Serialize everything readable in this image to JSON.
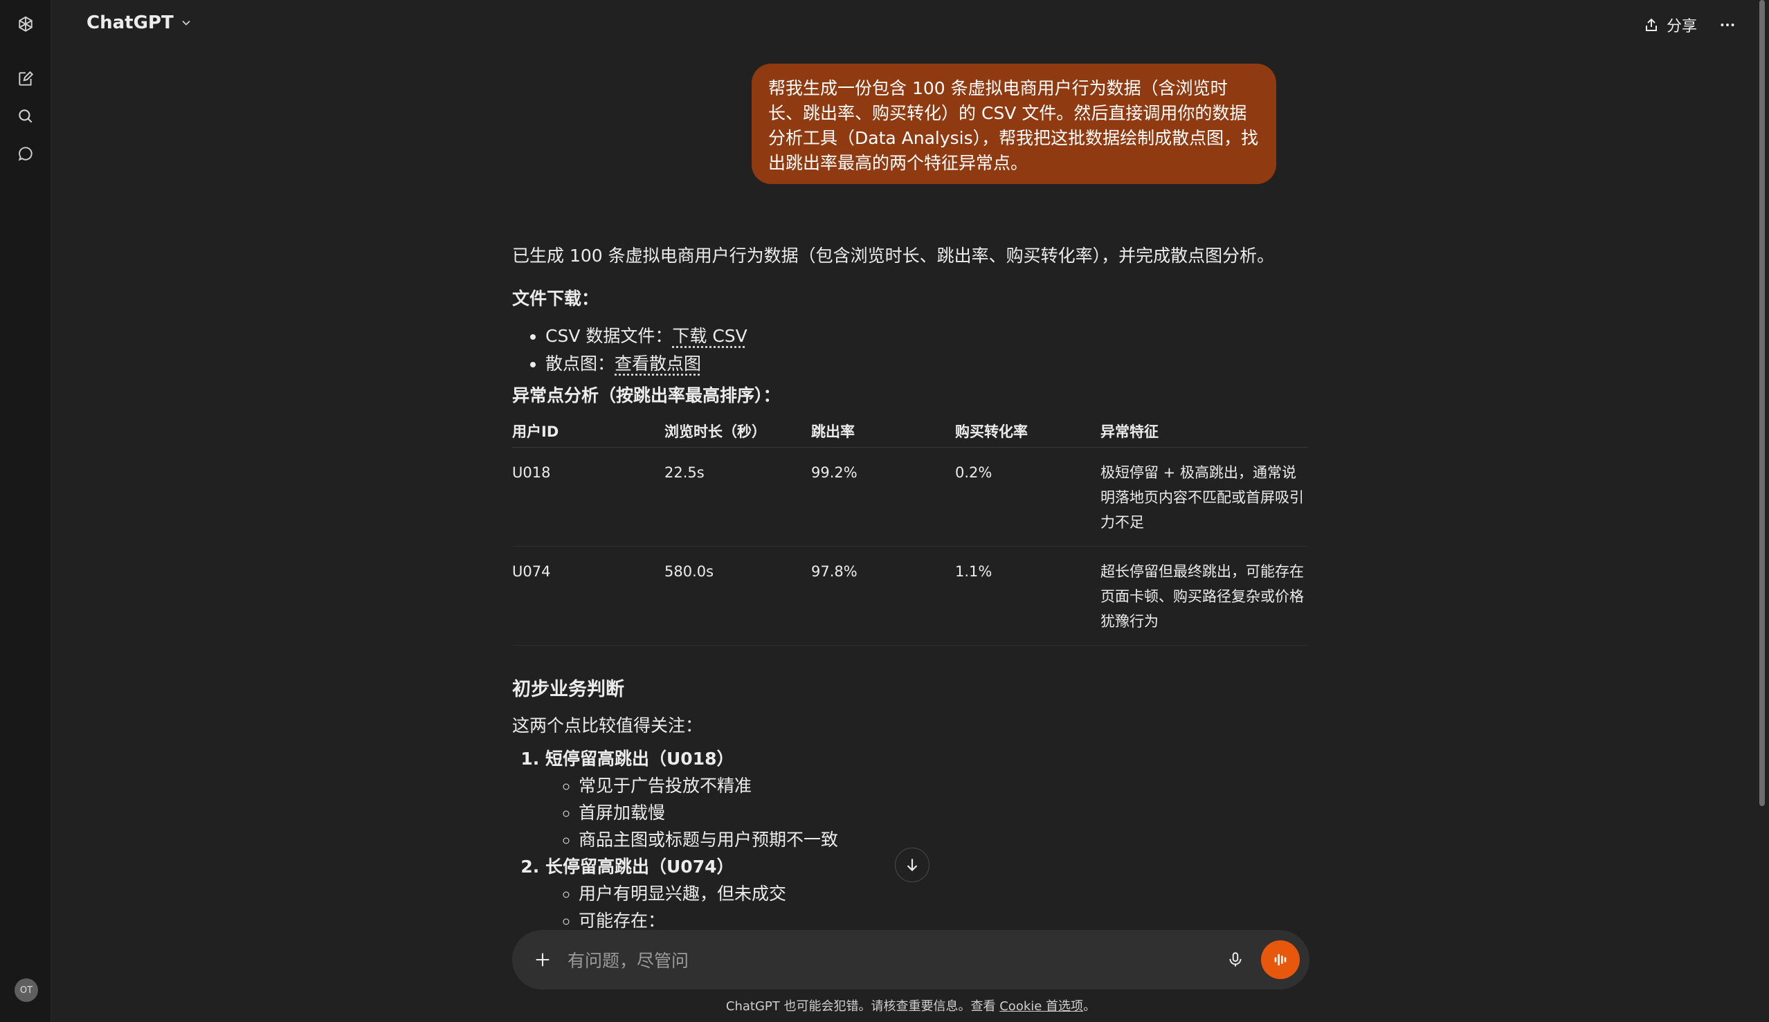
{
  "app": {
    "title": "ChatGPT",
    "share_label": "分享",
    "avatar_initials": "OT"
  },
  "sidebar": {
    "icons": [
      "openai-logo-icon",
      "new-chat-icon",
      "search-icon",
      "chat-bubble-icon"
    ]
  },
  "user_message": "帮我生成一份包含 100 条虚拟电商用户行为数据（含浏览时长、跳出率、购买转化）的 CSV 文件。然后直接调用你的数据分析工具（Data Analysis），帮我把这批数据绘制成散点图，找出跳出率最高的两个特征异常点。",
  "answer": {
    "intro": "已生成 100 条虚拟电商用户行为数据（包含浏览时长、跳出率、购买转化率），并完成散点图分析。",
    "files_heading": "文件下载：",
    "files": [
      {
        "label": "CSV 数据文件：",
        "link": "下载 CSV"
      },
      {
        "label": "散点图：",
        "link": "查看散点图"
      }
    ],
    "anomaly_heading": "异常点分析（按跳出率最高排序）：",
    "table": {
      "headers": [
        "用户ID",
        "浏览时长（秒）",
        "跳出率",
        "购买转化率",
        "异常特征"
      ],
      "rows": [
        [
          "U018",
          "22.5s",
          "99.2%",
          "0.2%",
          "极短停留 + 极高跳出，通常说明落地页内容不匹配或首屏吸引力不足"
        ],
        [
          "U074",
          "580.0s",
          "97.8%",
          "1.1%",
          "超长停留但最终跳出，可能存在页面卡顿、购买路径复杂或价格犹豫行为"
        ]
      ]
    },
    "judgement_heading": "初步业务判断",
    "judgement_intro": "这两个点比较值得关注：",
    "judgements": [
      {
        "title": "短停留高跳出（U018）",
        "items": [
          "常见于广告投放不精准",
          "首屏加载慢",
          "商品主图或标题与用户预期不一致"
        ]
      },
      {
        "title": "长停留高跳出（U074）",
        "items": [
          "用户有明显兴趣，但未成交",
          "可能存在："
        ]
      }
    ]
  },
  "composer": {
    "placeholder": "有问题，尽管问"
  },
  "footer": {
    "text": "ChatGPT 也可能会犯错。请核查重要信息。查看 ",
    "link": "Cookie 首选项",
    "suffix": "。"
  },
  "colors": {
    "background": "#212121",
    "sidebar": "#181818",
    "user_bubble": "#8f3a10",
    "voice_button": "#e8580c",
    "composer": "#303030"
  }
}
